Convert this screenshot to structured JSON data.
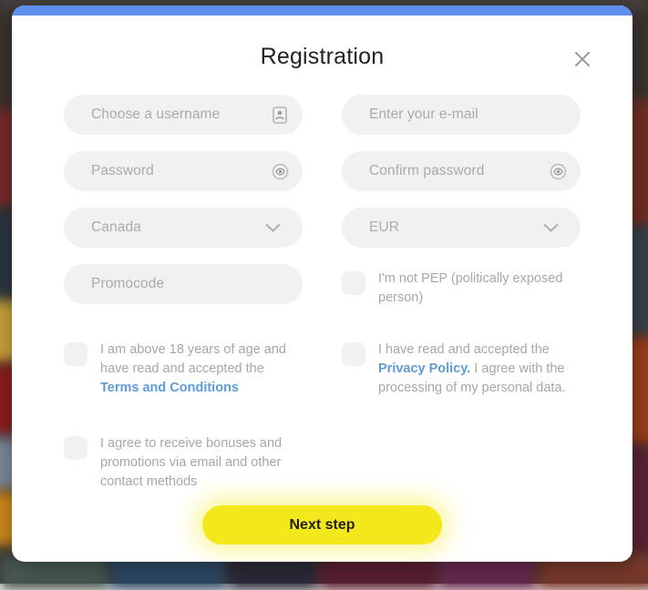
{
  "modal": {
    "title": "Registration",
    "accent_color": "#5e8eee",
    "close_icon": "close-icon"
  },
  "form": {
    "username": {
      "placeholder": "Choose a username",
      "icon": "id-card-icon"
    },
    "email": {
      "placeholder": "Enter your e-mail"
    },
    "password": {
      "placeholder": "Password",
      "icon": "eye-icon"
    },
    "confirm_password": {
      "placeholder": "Confirm password",
      "icon": "eye-icon"
    },
    "country": {
      "value": "Canada",
      "icon": "chevron-down-icon"
    },
    "currency": {
      "value": "EUR",
      "icon": "chevron-down-icon"
    },
    "promocode": {
      "placeholder": "Promocode"
    }
  },
  "checkboxes": {
    "pep": {
      "text": "I'm not PEP (politically exposed person)",
      "checked": false
    },
    "age_terms": {
      "text_before": "I am above 18 years of age and have read and accepted the ",
      "link": "Terms and Conditions",
      "text_after": "",
      "checked": false
    },
    "privacy": {
      "text_before": "I have read and accepted the ",
      "link": "Privacy Policy.",
      "text_after": " I agree with the processing of my personal data.",
      "checked": false
    },
    "bonuses": {
      "text": "I agree to receive bonuses and promotions via email and other contact methods",
      "checked": false
    }
  },
  "submit": {
    "label": "Next step",
    "color": "#f3e81c"
  },
  "colors": {
    "link": "#5e9bd8",
    "field_bg": "#f1f1f3",
    "placeholder": "#a9a9b0",
    "text_muted": "#a6a6ad"
  }
}
